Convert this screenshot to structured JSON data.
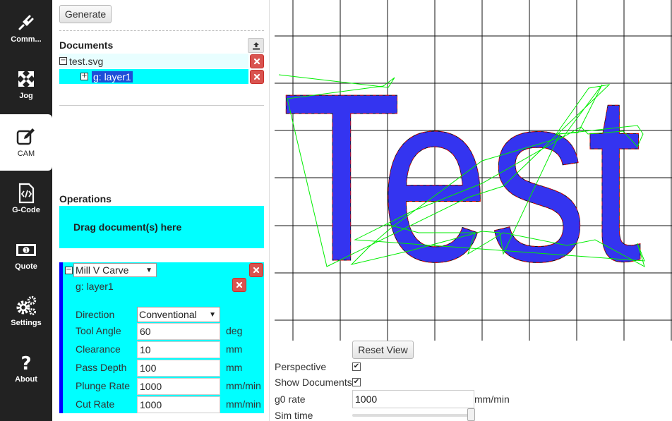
{
  "sidebar": {
    "items": [
      {
        "label": "Comm...",
        "icon": "plug-icon"
      },
      {
        "label": "Jog",
        "icon": "arrows-icon"
      },
      {
        "label": "CAM",
        "icon": "edit-icon",
        "active": true
      },
      {
        "label": "G-Code",
        "icon": "code-file-icon"
      },
      {
        "label": "Quote",
        "icon": "money-icon"
      },
      {
        "label": "Settings",
        "icon": "gears-icon"
      },
      {
        "label": "About",
        "icon": "question-icon"
      }
    ]
  },
  "toolbar": {
    "generate_label": "Generate"
  },
  "documents": {
    "title": "Documents",
    "items": [
      {
        "label": "test.svg",
        "tree": "⊟"
      },
      {
        "label": "g: layer1",
        "tree": "⊞",
        "selected": true
      }
    ]
  },
  "operations": {
    "title": "Operations",
    "drag_text": "Drag document(s) here",
    "op": {
      "type": "Mill V Carve",
      "document": "g: layer1",
      "direction": {
        "label": "Direction",
        "value": "Conventional"
      },
      "fields": [
        {
          "label": "Tool Angle",
          "value": "60",
          "unit": "deg"
        },
        {
          "label": "Clearance",
          "value": "10",
          "unit": "mm"
        },
        {
          "label": "Pass Depth",
          "value": "100",
          "unit": "mm"
        },
        {
          "label": "Plunge Rate",
          "value": "1000",
          "unit": "mm/min"
        },
        {
          "label": "Cut Rate",
          "value": "1000",
          "unit": "mm/min"
        }
      ]
    }
  },
  "viewport": {
    "text": "Test",
    "colors": {
      "fill": "#3434f0",
      "outline": "#111111",
      "toolpath": "#ff0000",
      "rapid": "#00ee00",
      "grid": "#111111"
    }
  },
  "view_controls": {
    "reset_label": "Reset View",
    "perspective_label": "Perspective",
    "perspective_checked": "✔",
    "show_documents_label": "Show Documents",
    "show_documents_checked": "✔",
    "g0_label": "g0 rate",
    "g0_value": "1000",
    "g0_unit": "mm/min",
    "sim_label": "Sim time"
  }
}
